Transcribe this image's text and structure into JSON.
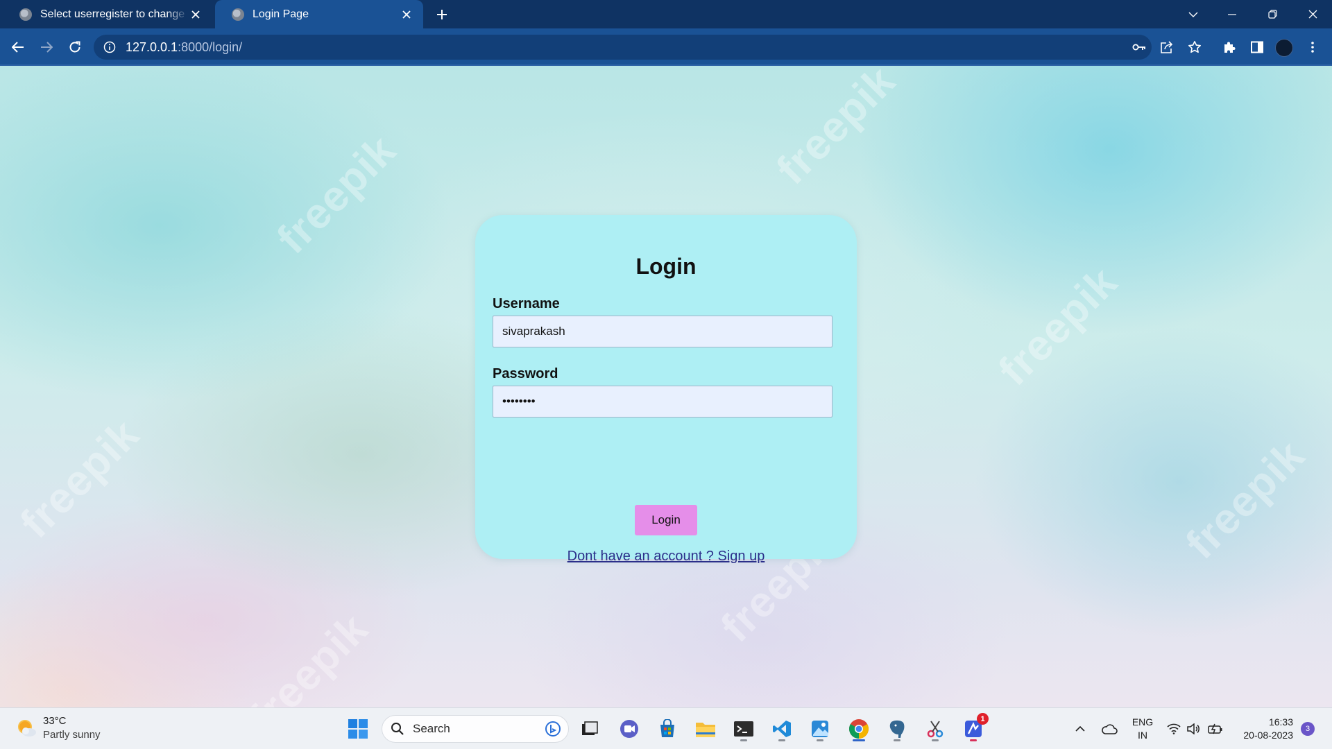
{
  "browser": {
    "tabs": [
      {
        "title": "Select userregister to change | Django site admin",
        "active": false
      },
      {
        "title": "Login Page",
        "active": true
      }
    ],
    "url_host": "127.0.0.1",
    "url_path": ":8000/login/"
  },
  "watermark": "freepik",
  "login_form": {
    "title": "Login",
    "username_label": "Username",
    "username_value": "sivaprakash",
    "password_label": "Password",
    "password_value": "••••••••",
    "submit_label": "Login",
    "signup_link": "Dont have an account ? Sign up",
    "card_color": "#aeeff4",
    "button_color": "#e58ee9"
  },
  "taskbar": {
    "weather_temp": "33°C",
    "weather_desc": "Partly sunny",
    "search_placeholder": "Search",
    "language_line1": "ENG",
    "language_line2": "IN",
    "time": "16:33",
    "date": "20-08-2023",
    "notification_count": "3",
    "app_badge_count": "1"
  }
}
